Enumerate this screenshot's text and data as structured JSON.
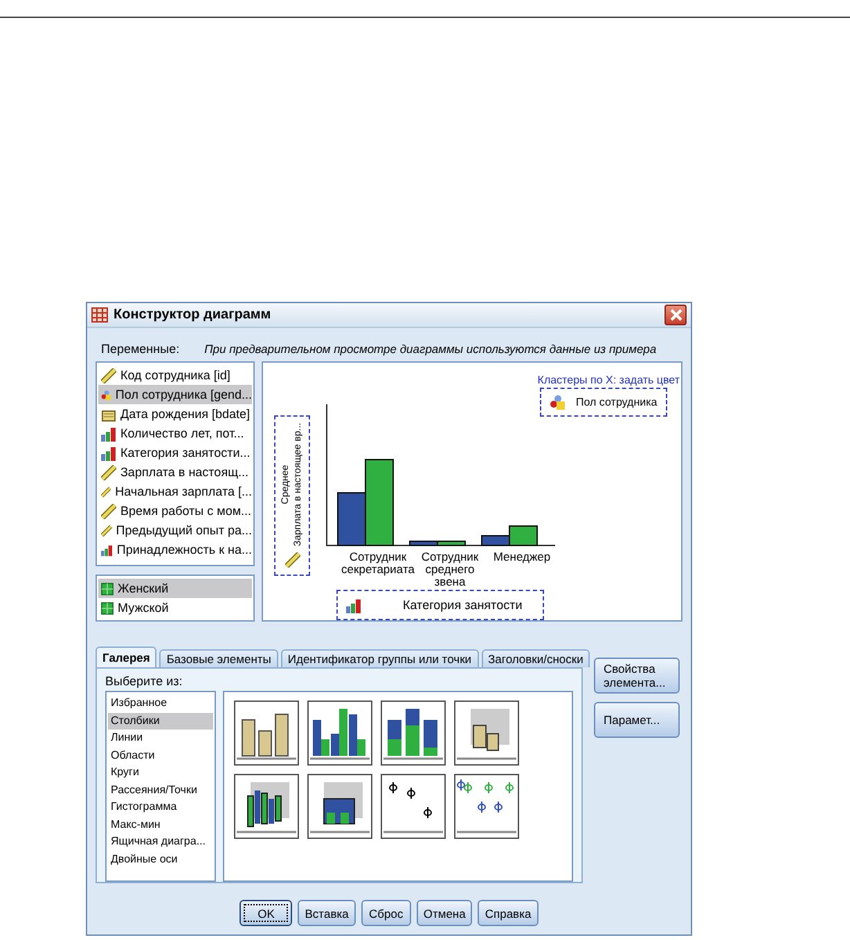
{
  "window": {
    "title": "Конструктор диаграмм"
  },
  "variables_label": "Переменные:",
  "preview_note": "При предварительном просмотре диаграммы используются данные из примера",
  "variables": [
    {
      "name": "Код сотрудника [id]",
      "kind": "scale",
      "selected": false
    },
    {
      "name": "Пол сотрудника [gend...",
      "kind": "nominal",
      "selected": true
    },
    {
      "name": "Дата рождения [bdate]",
      "kind": "date",
      "selected": false
    },
    {
      "name": "Количество лет, пот...",
      "kind": "ordinal",
      "selected": false
    },
    {
      "name": "Категория занятости...",
      "kind": "ordinal",
      "selected": false
    },
    {
      "name": "Зарплата в настоящ...",
      "kind": "scale",
      "selected": false
    },
    {
      "name": "Начальная зарплата [...",
      "kind": "scale",
      "selected": false
    },
    {
      "name": "Время работы с мом...",
      "kind": "scale",
      "selected": false
    },
    {
      "name": "Предыдущий опыт ра...",
      "kind": "scale",
      "selected": false
    },
    {
      "name": "Принадлежность к на...",
      "kind": "ordinal",
      "selected": false
    }
  ],
  "values": [
    {
      "name": "Женский",
      "selected": true
    },
    {
      "name": "Мужской",
      "selected": false
    }
  ],
  "preview": {
    "cluster_label": "Кластеры по X: задать цвет",
    "legend": "Пол сотрудника",
    "y_zone": [
      "Среднее",
      "Зарплата в настоящее вр..."
    ],
    "categories": [
      "Сотрудник секретариата",
      "Сотрудник среднего звена",
      "Менеджер"
    ],
    "x_zone": "Категория занятости"
  },
  "tabs": [
    {
      "label": "Галерея",
      "selected": true
    },
    {
      "label": "Базовые элементы",
      "selected": false
    },
    {
      "label": "Идентификатор группы или точки",
      "selected": false
    },
    {
      "label": "Заголовки/сноски",
      "selected": false
    }
  ],
  "choose_label": "Выберите из:",
  "chart_types": [
    {
      "label": "Избранное",
      "selected": false
    },
    {
      "label": "Столбики",
      "selected": true
    },
    {
      "label": "Линии",
      "selected": false
    },
    {
      "label": "Области",
      "selected": false
    },
    {
      "label": "Круги",
      "selected": false
    },
    {
      "label": "Рассеяния/Точки",
      "selected": false
    },
    {
      "label": "Гистограмма",
      "selected": false
    },
    {
      "label": "Макс-мин",
      "selected": false
    },
    {
      "label": "Ящичная диагра...",
      "selected": false
    },
    {
      "label": "Двойные оси",
      "selected": false
    }
  ],
  "side_buttons": [
    "Свойства элемента...",
    "Парамет..."
  ],
  "buttons": [
    {
      "label": "OK",
      "default": true
    },
    {
      "label": "Вставка",
      "default": false
    },
    {
      "label": "Сброс",
      "default": false
    },
    {
      "label": "Отмена",
      "default": false
    },
    {
      "label": "Справка",
      "default": false
    }
  ]
}
